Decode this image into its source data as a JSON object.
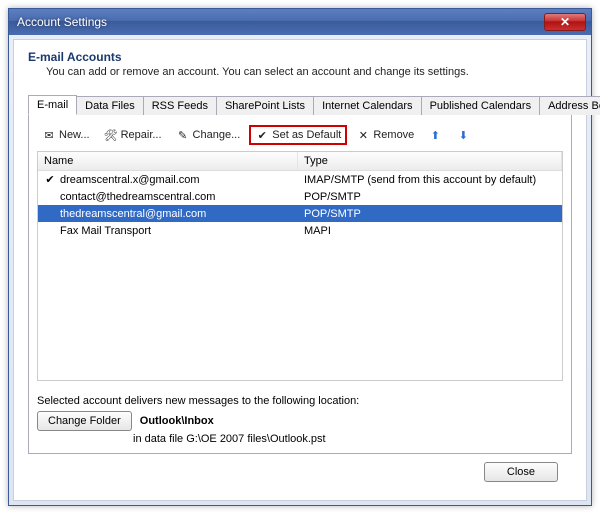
{
  "window": {
    "title": "Account Settings",
    "close_glyph": "✕"
  },
  "header": {
    "title": "E-mail Accounts",
    "desc": "You can add or remove an account. You can select an account and change its settings."
  },
  "tabs": [
    {
      "label": "E-mail",
      "active": true
    },
    {
      "label": "Data Files",
      "active": false
    },
    {
      "label": "RSS Feeds",
      "active": false
    },
    {
      "label": "SharePoint Lists",
      "active": false
    },
    {
      "label": "Internet Calendars",
      "active": false
    },
    {
      "label": "Published Calendars",
      "active": false
    },
    {
      "label": "Address Books",
      "active": false
    }
  ],
  "toolbar": {
    "new": "New...",
    "repair": "Repair...",
    "change": "Change...",
    "set_default": "Set as Default",
    "remove": "Remove"
  },
  "list": {
    "columns": {
      "name": "Name",
      "type": "Type"
    },
    "rows": [
      {
        "name": "dreamscentral.x@gmail.com",
        "type": "IMAP/SMTP (send from this account by default)",
        "default": true,
        "selected": false
      },
      {
        "name": "contact@thedreamscentral.com",
        "type": "POP/SMTP",
        "default": false,
        "selected": false
      },
      {
        "name": "thedreamscentral@gmail.com",
        "type": "POP/SMTP",
        "default": false,
        "selected": true
      },
      {
        "name": "Fax Mail Transport",
        "type": "MAPI",
        "default": false,
        "selected": false
      }
    ]
  },
  "delivery": {
    "label": "Selected account delivers new messages to the following location:",
    "change_folder": "Change Folder",
    "location": "Outlook\\Inbox",
    "datafile": "in data file G:\\OE 2007 files\\Outlook.pst"
  },
  "footer": {
    "close": "Close"
  },
  "icons": {
    "new": "✉",
    "repair": "🛠",
    "change": "✎",
    "set_default": "✔",
    "remove": "✕",
    "up": "⬆",
    "down": "⬇",
    "check": "✔"
  }
}
